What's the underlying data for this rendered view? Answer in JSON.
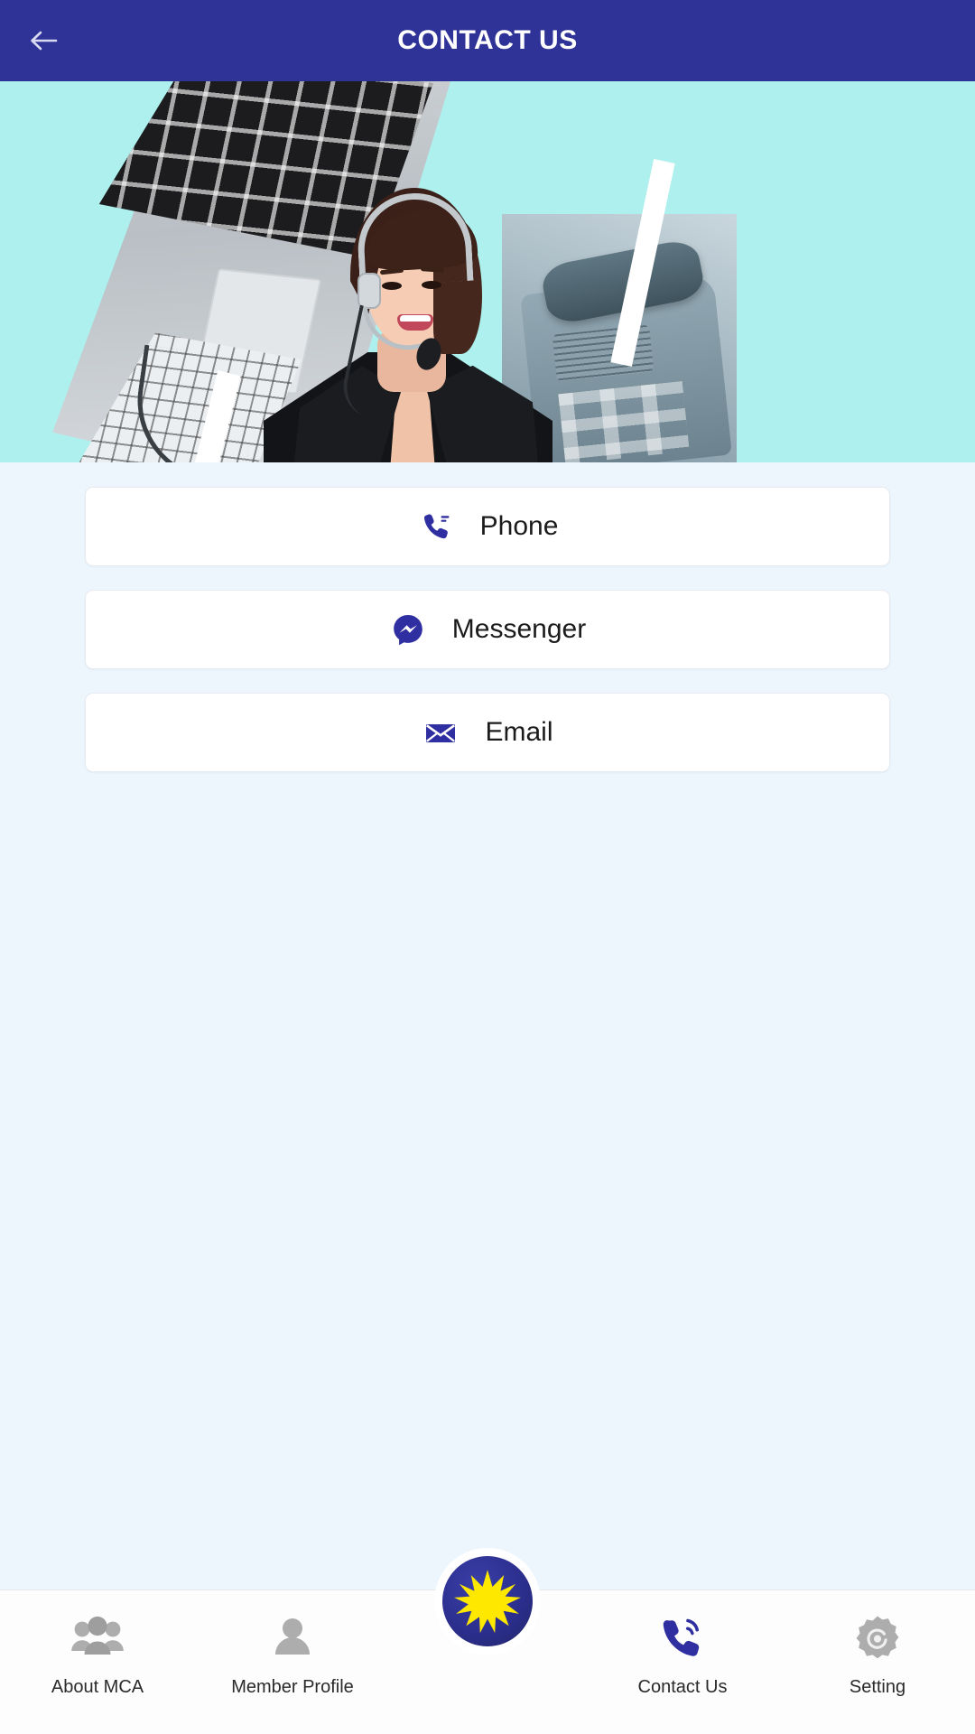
{
  "header": {
    "title": "CONTACT US",
    "back_icon": "arrow-left-icon",
    "background_color": "#2F3296",
    "title_color": "#FFFFFF"
  },
  "hero": {
    "alt": "call-center-agent-with-headset-banner",
    "background_color": "#AEF0EE",
    "elements": [
      "laptop-keyboard",
      "desk-phone",
      "white-diagonal-stripes",
      "woman-with-headset"
    ]
  },
  "contact_options": [
    {
      "label": "Phone",
      "icon": "phone-handset-icon",
      "icon_color": "#2F2FA2"
    },
    {
      "label": "Messenger",
      "icon": "facebook-messenger-icon",
      "icon_color": "#2F2FA2"
    },
    {
      "label": "Email",
      "icon": "envelope-icon",
      "icon_color": "#2F2FA2"
    }
  ],
  "bottom_nav": {
    "items": [
      {
        "label": "About MCA",
        "icon": "people-group-icon",
        "active": false,
        "color": "#ADADAD"
      },
      {
        "label": "Member Profile",
        "icon": "person-icon",
        "active": false,
        "color": "#ADADAD"
      },
      {
        "label": "",
        "icon": "mca-star-logo-icon",
        "active": false,
        "color": "#2B2E8C"
      },
      {
        "label": "Contact Us",
        "icon": "phone-call-icon",
        "active": true,
        "color": "#2F2FA2"
      },
      {
        "label": "Setting",
        "icon": "gear-icon",
        "active": false,
        "color": "#ADADAD"
      }
    ],
    "logo": {
      "circle_color": "#2B2E8C",
      "star_color": "#FFE800",
      "star_points": 14
    }
  },
  "theme": {
    "page_background": "#EDF6FD",
    "card_background": "#FFFFFF",
    "card_border": "#E7EAF0",
    "primary": "#2F3296",
    "accent_blue": "#2F2FA2"
  }
}
